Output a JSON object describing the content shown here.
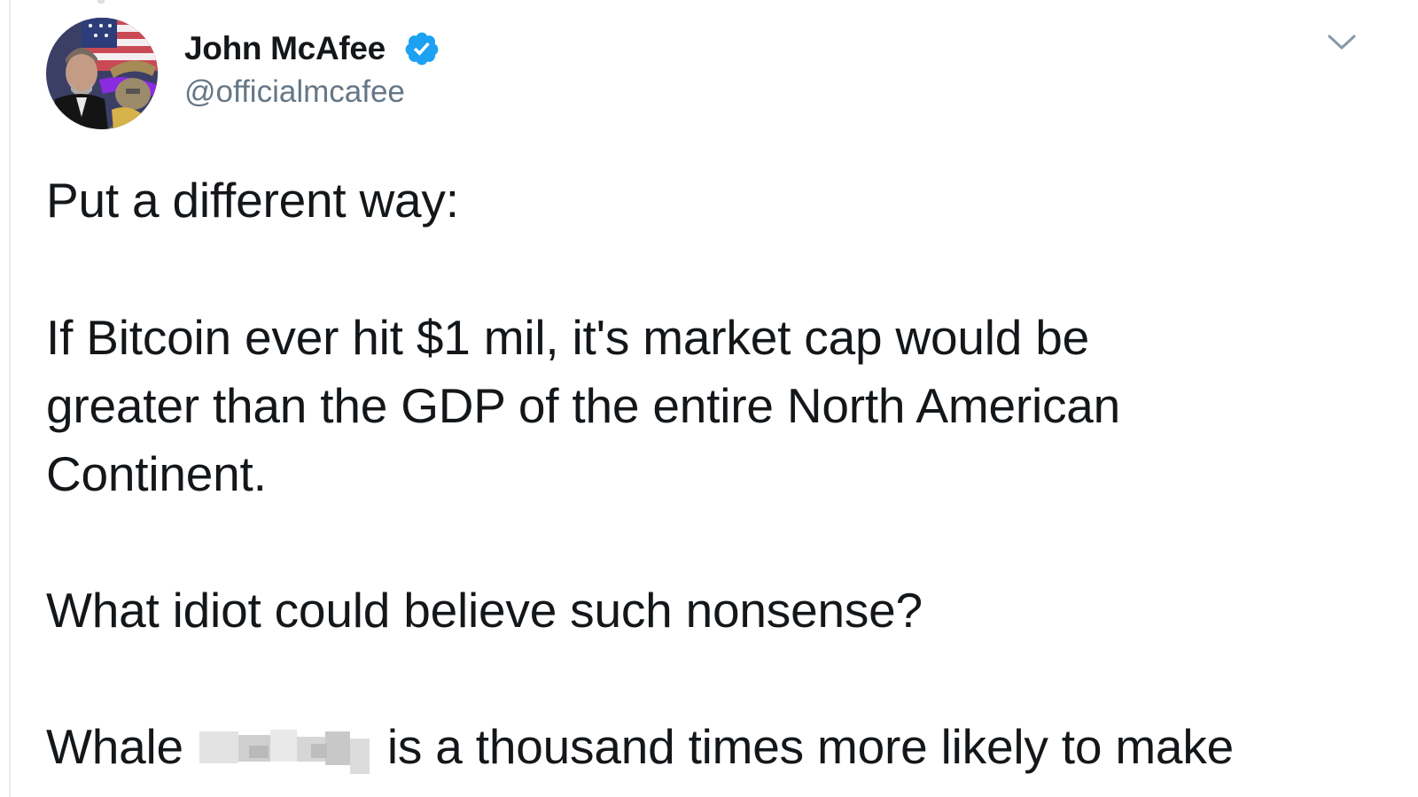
{
  "tweet": {
    "author": {
      "name": "John McAfee",
      "handle": "@officialmcafee",
      "verified": true,
      "avatar_description": "avatar-image"
    },
    "body": {
      "line1": "Put a different way:",
      "line2": "If Bitcoin ever hit $1 mil, it's market cap would be",
      "line3": "greater than the GDP of the entire North American",
      "line4": "Continent.",
      "line5": "What idiot could believe such nonsense?",
      "line6_start": "Whale",
      "line6_end": "is a thousand times more likely to make"
    },
    "menu_icon": "chevron-down-icon",
    "verified_icon": "verified-badge-icon"
  },
  "colors": {
    "text": "#14171a",
    "secondary_text": "#657786",
    "verified_blue": "#1da1f2",
    "caret_gray": "#8899a6",
    "border": "#e6ecf0"
  }
}
